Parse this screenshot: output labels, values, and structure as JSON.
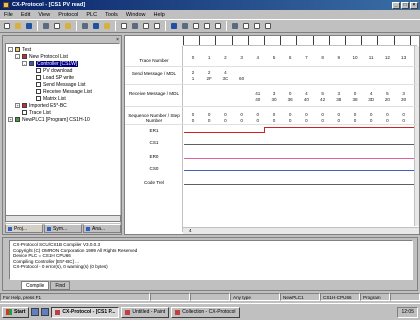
{
  "window": {
    "title": "CX-Protocol - [CS1 PV read]",
    "buttons": [
      "_",
      "□",
      "×"
    ]
  },
  "menu": [
    "File",
    "Edit",
    "View",
    "Protocol",
    "PLC",
    "Tools",
    "Window",
    "Help"
  ],
  "tree": {
    "items": [
      {
        "label": "Test",
        "icon": "folder-icon",
        "indent": 0,
        "exp": "-"
      },
      {
        "label": "New Protocol List",
        "icon": "protocol-icon",
        "indent": 1,
        "exp": "-"
      },
      {
        "label": "Controller [CS1W]",
        "icon": "sequence-icon",
        "indent": 2,
        "exp": "-",
        "selected": true
      },
      {
        "label": "PV download",
        "icon": "document-icon",
        "indent": 3,
        "exp": ""
      },
      {
        "label": "Load SP write",
        "icon": "document-icon",
        "indent": 3,
        "exp": ""
      },
      {
        "label": "Send Message List",
        "icon": "document-icon",
        "indent": 3,
        "exp": ""
      },
      {
        "label": "Receive Message List",
        "icon": "document-icon",
        "indent": 3,
        "exp": ""
      },
      {
        "label": "Matrix List",
        "icon": "document-icon",
        "indent": 3,
        "exp": ""
      },
      {
        "label": "Imported E5*-BC",
        "icon": "protocol-icon",
        "indent": 1,
        "exp": "+"
      },
      {
        "label": "Trace List",
        "icon": "document-icon",
        "indent": 1,
        "exp": ""
      },
      {
        "label": "NewPLC1 [Program] CS1H-10",
        "icon": "network-icon",
        "indent": 0,
        "exp": "+"
      }
    ],
    "tabs": [
      "Proj...",
      "Sym...",
      "Ana..."
    ]
  },
  "chart": {
    "row_labels": [
      {
        "text": "Trace Number",
        "lines": 1
      },
      {
        "text": "Send Message / MDL",
        "lines": 2
      },
      {
        "text": "Receive Message / MDL",
        "lines": 2
      },
      {
        "text": "Sequence Number / Step Number",
        "lines": 2
      },
      {
        "text": "ER1",
        "lines": 1
      },
      {
        "text": "CS1",
        "lines": 1
      },
      {
        "text": "ER0",
        "lines": 1
      },
      {
        "text": "CS0",
        "lines": 1
      },
      {
        "text": "Code Trel",
        "lines": 1
      }
    ],
    "trace_numbers": [
      "0",
      "1",
      "2",
      "3",
      "4",
      "5",
      "6",
      "7",
      "8",
      "9",
      "10",
      "11",
      "12",
      "13"
    ],
    "send_message": [
      "2",
      "2",
      "4",
      "",
      "",
      "",
      "",
      "",
      "",
      "",
      "",
      "",
      "",
      ""
    ],
    "send_mdl": [
      "1",
      "2F",
      "3C",
      "60",
      "",
      "",
      "",
      "",
      "",
      "",
      "",
      "",
      "",
      ""
    ],
    "receive_message": [
      "",
      "",
      "",
      "",
      "41",
      "3",
      "0",
      "4",
      "5",
      "3",
      "0",
      "4",
      "5",
      "3"
    ],
    "receive_mdl": [
      "",
      "",
      "",
      "",
      "40",
      "30",
      "36",
      "40",
      "42",
      "38",
      "38",
      "3D",
      "20",
      "30"
    ],
    "seq_number": [
      "0",
      "0",
      "0",
      "0",
      "0",
      "0",
      "0",
      "0",
      "0",
      "0",
      "0",
      "0",
      "0",
      "0"
    ],
    "step_number": [
      "0",
      "0",
      "0",
      "0",
      "0",
      "0",
      "0",
      "0",
      "0",
      "0",
      "0",
      "0",
      "0",
      "0"
    ],
    "scroll_label": "4"
  },
  "output": {
    "lines": [
      "CX-Protocol SCU/CS1B Compiler V3.0.0.3",
      "Copyright (C) OMRON Corporation 1999 All Rights Reserved",
      "Device PLC = CS1H CPU66",
      "Compiling Controller [E5*-BC] ...",
      "CX-Protocol - 0 error(s), 0 warning(s) (0 bytes)"
    ],
    "tabs": [
      "Compile",
      "Find"
    ]
  },
  "status": {
    "cells": [
      "For Help, press F1",
      "",
      "",
      "Any type",
      "NewPLC1",
      "CS1H-CPU66",
      "Program",
      ""
    ]
  },
  "taskbar": {
    "start": "Start",
    "tasks": [
      {
        "label": "CX-Protocol - [CS1 P...",
        "active": true
      },
      {
        "label": "Untitled - Paint",
        "active": false
      },
      {
        "label": "Collection - CX-Protocol",
        "active": false
      }
    ],
    "clock": "12:05"
  }
}
